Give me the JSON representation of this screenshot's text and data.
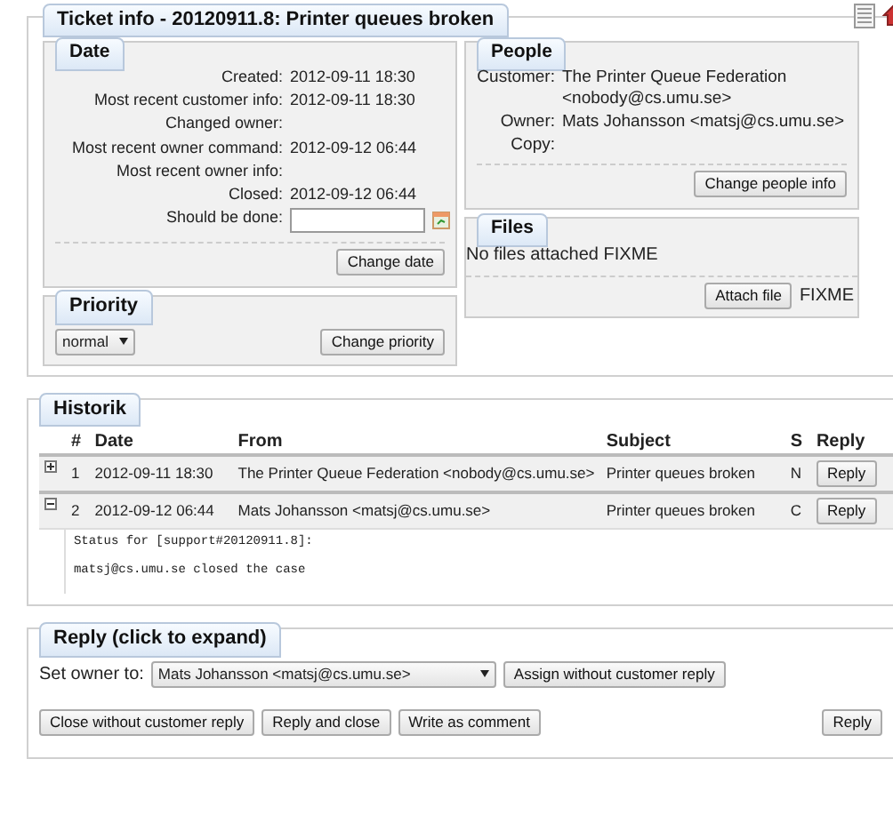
{
  "ticket_info": {
    "title": "Ticket info - 20120911.8: Printer queues broken",
    "date": {
      "title": "Date",
      "fields": [
        {
          "label": "Created:",
          "value": "2012-09-11 18:30"
        },
        {
          "label": "Most recent customer info:",
          "value": "2012-09-11 18:30"
        },
        {
          "label": "Changed owner:"
        },
        {
          "label": "Most recent owner command:",
          "value": "2012-09-12 06:44"
        },
        {
          "label": "Most recent owner info:"
        },
        {
          "label": "Closed:",
          "value": "2012-09-12 06:44"
        }
      ],
      "should_be_done": {
        "label": "Should be done:"
      },
      "button": "Change date"
    },
    "priority": {
      "title": "Priority",
      "value": "normal",
      "button": "Change priority"
    },
    "people": {
      "title": "People",
      "fields": [
        {
          "label": "Customer:",
          "value": "The Printer Queue Federation <nobody@cs.umu.se>"
        },
        {
          "label": "Owner:",
          "value": "Mats Johansson <matsj@cs.umu.se>"
        },
        {
          "label": "Copy:"
        }
      ],
      "button": "Change people info"
    },
    "files": {
      "title": "Files",
      "text": "No files attached FIXME",
      "button": "Attach file",
      "note": "FIXME"
    }
  },
  "history": {
    "title": "Historik",
    "columns": [
      "#",
      "Date",
      "From",
      "Subject",
      "S",
      "Reply"
    ],
    "rows": [
      {
        "number": "1",
        "date": "2012-09-11 18:30",
        "from": "The Printer Queue Federation <nobody@cs.umu.se>",
        "subject": "Printer queues broken",
        "status": "N",
        "button": "Reply",
        "expanded": false,
        "body": []
      },
      {
        "number": "2",
        "date": "2012-09-12 06:44",
        "from": "Mats Johansson <matsj@cs.umu.se>",
        "subject": "Printer queues broken",
        "status": "C",
        "button": "Reply",
        "expanded": true,
        "body": [
          "Status for [support#20120911.8]:",
          "matsj@cs.umu.se closed the case"
        ]
      }
    ]
  },
  "reply": {
    "title": "Reply (click to expand)",
    "owner_label": "Set owner to:",
    "owner_value": "Mats Johansson <matsj@cs.umu.se>",
    "assign_button": "Assign without customer reply",
    "buttons": [
      "Close without customer reply",
      "Reply and close",
      "Write as comment"
    ],
    "reply_button": "Reply"
  }
}
